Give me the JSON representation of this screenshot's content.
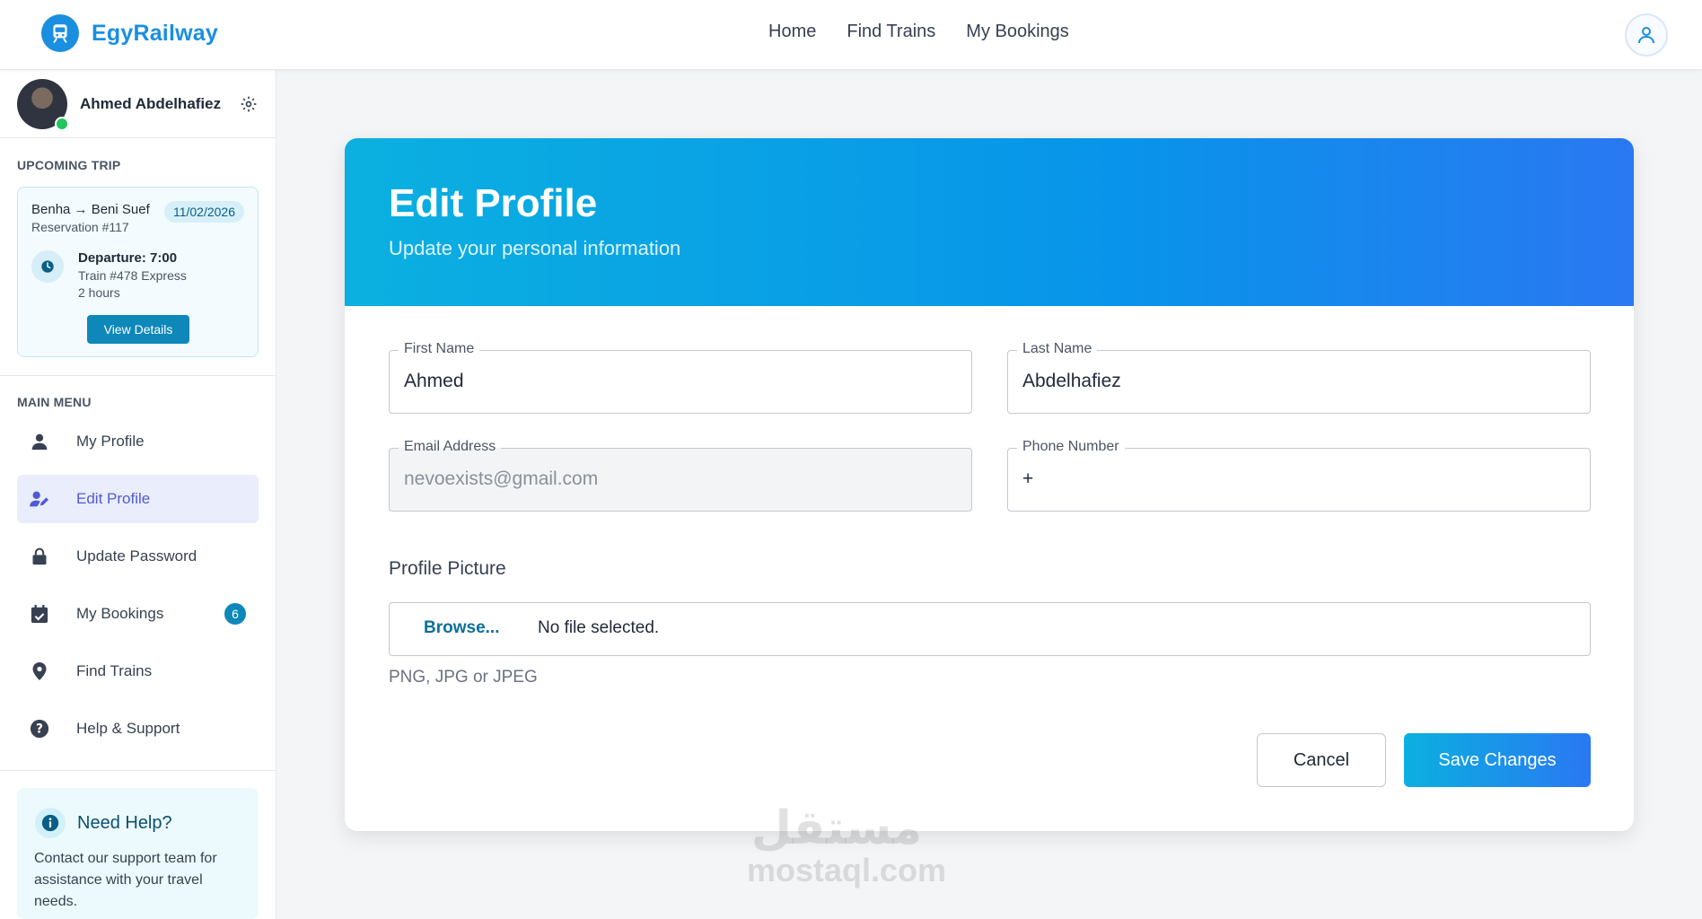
{
  "brand": {
    "name": "EgyRailway"
  },
  "nav": {
    "home": "Home",
    "find_trains": "Find Trains",
    "my_bookings": "My Bookings"
  },
  "sidebar": {
    "user_name": "Ahmed Abdelhafiez",
    "upcoming_label": "UPCOMING TRIP",
    "trip": {
      "route": "Benha → Beni Suef",
      "reservation": "Reservation #117",
      "date": "11/02/2026",
      "departure": "Departure: 7:00",
      "train": "Train #478 Express",
      "duration": "2 hours",
      "view_details": "View Details"
    },
    "menu_label": "MAIN MENU",
    "menu": [
      {
        "label": "My Profile",
        "icon": "user-icon"
      },
      {
        "label": "Edit Profile",
        "icon": "user-edit-icon",
        "active": true
      },
      {
        "label": "Update Password",
        "icon": "lock-icon"
      },
      {
        "label": "My Bookings",
        "icon": "calendar-check-icon",
        "badge": "6"
      },
      {
        "label": "Find Trains",
        "icon": "map-pin-icon"
      },
      {
        "label": "Help & Support",
        "icon": "question-icon"
      }
    ],
    "help": {
      "title": "Need Help?",
      "text": "Contact our support team for assistance with your travel needs."
    }
  },
  "form": {
    "title": "Edit Profile",
    "subtitle": "Update your personal information",
    "first_name": {
      "label": "First Name",
      "value": "Ahmed"
    },
    "last_name": {
      "label": "Last Name",
      "value": "Abdelhafiez"
    },
    "email": {
      "label": "Email Address",
      "value": "nevoexists@gmail.com"
    },
    "phone": {
      "label": "Phone Number",
      "value": "+"
    },
    "picture": {
      "label": "Profile Picture",
      "browse": "Browse...",
      "status": "No file selected.",
      "hint": "PNG, JPG or JPEG"
    },
    "cancel": "Cancel",
    "save": "Save Changes"
  },
  "watermark": {
    "arabic": "مستقل",
    "latin": "mostaql.com"
  },
  "colors": {
    "brand": "#1a8fe0",
    "accent": "#0e87b9",
    "active_menu": "#4f5bd5",
    "online": "#22c55e"
  }
}
